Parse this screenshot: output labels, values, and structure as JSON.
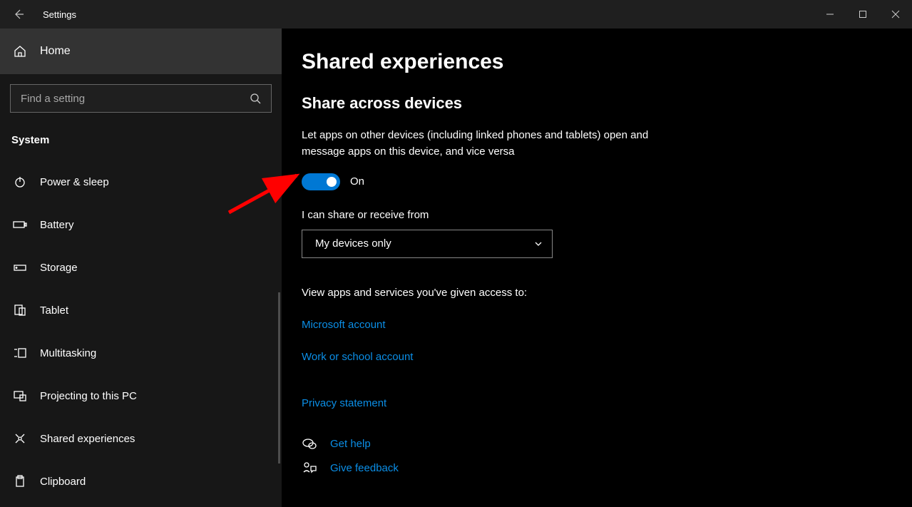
{
  "titlebar": {
    "title": "Settings"
  },
  "sidebar": {
    "home_label": "Home",
    "search_placeholder": "Find a setting",
    "section_label": "System",
    "items": [
      {
        "label": "Power & sleep"
      },
      {
        "label": "Battery"
      },
      {
        "label": "Storage"
      },
      {
        "label": "Tablet"
      },
      {
        "label": "Multitasking"
      },
      {
        "label": "Projecting to this PC"
      },
      {
        "label": "Shared experiences"
      },
      {
        "label": "Clipboard"
      }
    ]
  },
  "main": {
    "page_title": "Shared experiences",
    "subheading": "Share across devices",
    "description": "Let apps on other devices (including linked phones and tablets) open and message apps on this device, and vice versa",
    "toggle_state": "On",
    "share_from_label": "I can share or receive from",
    "dropdown_value": "My devices only",
    "access_text": "View apps and services you've given access to:",
    "links": {
      "msaccount": "Microsoft account",
      "workaccount": "Work or school account",
      "privacy": "Privacy statement"
    },
    "help": {
      "get_help": "Get help",
      "feedback": "Give feedback"
    }
  }
}
